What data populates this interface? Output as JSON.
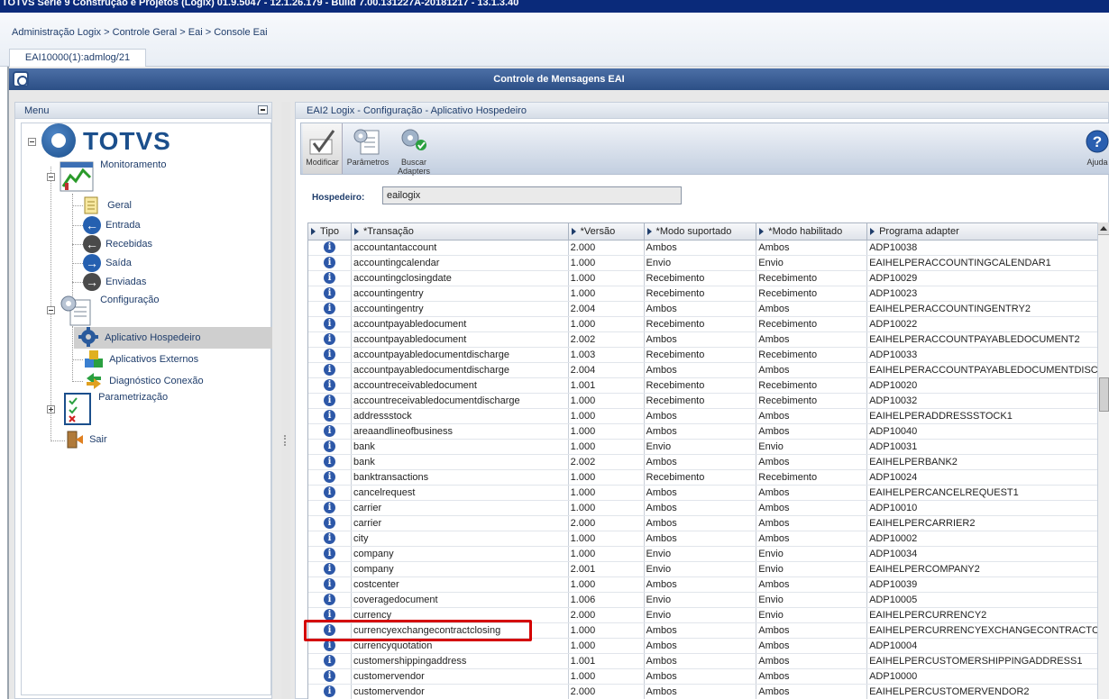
{
  "window": {
    "title": "TOTVS Série 9 Construção e Projetos (Logix) 01.9.5047 - 12.1.26.179 - Build 7.00.131227A-20181217 - 13.1.3.40"
  },
  "breadcrumb": [
    "Administração Logix",
    "Controle Geral",
    "Eai",
    "Console Eai"
  ],
  "breadcrumb_sep": ">",
  "session_tab": "EAI10000(1):admlog/21",
  "header_title": "Controle de Mensagens EAI",
  "menu": {
    "title": "Menu",
    "logo_text": "TOTVS",
    "groups": [
      {
        "label": "Monitoramento",
        "items": [
          "Geral",
          "Entrada",
          "Recebidas",
          "Saída",
          "Enviadas"
        ]
      },
      {
        "label": "Configuração",
        "items": [
          "Aplicativo Hospedeiro",
          "Aplicativos Externos",
          "Diagnóstico Conexão"
        ]
      },
      {
        "label": "Parametrização",
        "items": []
      },
      {
        "label": "Sair",
        "items": []
      }
    ]
  },
  "content": {
    "breadcrumb": "EAI2 Logix - Configuração - Aplicativo Hospedeiro",
    "toolbar": [
      {
        "label": "Modificar",
        "icon": "pencil-check-icon"
      },
      {
        "label": "Parâmetros",
        "icon": "document-gear-icon"
      },
      {
        "label": "Buscar Adapters",
        "icon": "gears-icon"
      }
    ],
    "help_label": "Ajuda",
    "host_label": "Hospedeiro:",
    "host_value": "eailogix"
  },
  "table": {
    "columns": [
      "Tipo",
      "*Transação",
      "*Versão",
      "*Modo suportado",
      "*Modo habilitado",
      "Programa adapter"
    ],
    "rows": [
      [
        "accountantaccount",
        "2.000",
        "Ambos",
        "Ambos",
        "ADP10038"
      ],
      [
        "accountingcalendar",
        "1.000",
        "Envio",
        "Envio",
        "EAIHELPERACCOUNTINGCALENDAR1"
      ],
      [
        "accountingclosingdate",
        "1.000",
        "Recebimento",
        "Recebimento",
        "ADP10029"
      ],
      [
        "accountingentry",
        "1.000",
        "Recebimento",
        "Recebimento",
        "ADP10023"
      ],
      [
        "accountingentry",
        "2.004",
        "Ambos",
        "Ambos",
        "EAIHELPERACCOUNTINGENTRY2"
      ],
      [
        "accountpayabledocument",
        "1.000",
        "Recebimento",
        "Recebimento",
        "ADP10022"
      ],
      [
        "accountpayabledocument",
        "2.002",
        "Ambos",
        "Ambos",
        "EAIHELPERACCOUNTPAYABLEDOCUMENT2"
      ],
      [
        "accountpayabledocumentdischarge",
        "1.003",
        "Recebimento",
        "Recebimento",
        "ADP10033"
      ],
      [
        "accountpayabledocumentdischarge",
        "2.004",
        "Ambos",
        "Ambos",
        "EAIHELPERACCOUNTPAYABLEDOCUMENTDISC"
      ],
      [
        "accountreceivabledocument",
        "1.001",
        "Recebimento",
        "Recebimento",
        "ADP10020"
      ],
      [
        "accountreceivabledocumentdischarge",
        "1.000",
        "Recebimento",
        "Recebimento",
        "ADP10032"
      ],
      [
        "addressstock",
        "1.000",
        "Ambos",
        "Ambos",
        "EAIHELPERADDRESSSTOCK1"
      ],
      [
        "areaandlineofbusiness",
        "1.000",
        "Ambos",
        "Ambos",
        "ADP10040"
      ],
      [
        "bank",
        "1.000",
        "Envio",
        "Envio",
        "ADP10031"
      ],
      [
        "bank",
        "2.002",
        "Ambos",
        "Ambos",
        "EAIHELPERBANK2"
      ],
      [
        "banktransactions",
        "1.000",
        "Recebimento",
        "Recebimento",
        "ADP10024"
      ],
      [
        "cancelrequest",
        "1.000",
        "Ambos",
        "Ambos",
        "EAIHELPERCANCELREQUEST1"
      ],
      [
        "carrier",
        "1.000",
        "Ambos",
        "Ambos",
        "ADP10010"
      ],
      [
        "carrier",
        "2.000",
        "Ambos",
        "Ambos",
        "EAIHELPERCARRIER2"
      ],
      [
        "city",
        "1.000",
        "Ambos",
        "Ambos",
        "ADP10002"
      ],
      [
        "company",
        "1.000",
        "Envio",
        "Envio",
        "ADP10034"
      ],
      [
        "company",
        "2.001",
        "Envio",
        "Envio",
        "EAIHELPERCOMPANY2"
      ],
      [
        "costcenter",
        "1.000",
        "Ambos",
        "Ambos",
        "ADP10039"
      ],
      [
        "coveragedocument",
        "1.006",
        "Envio",
        "Envio",
        "ADP10005"
      ],
      [
        "currency",
        "2.000",
        "Envio",
        "Envio",
        "EAIHELPERCURRENCY2"
      ],
      [
        "currencyexchangecontractclosing",
        "1.000",
        "Ambos",
        "Ambos",
        "EAIHELPERCURRENCYEXCHANGECONTRACTC"
      ],
      [
        "currencyquotation",
        "1.000",
        "Ambos",
        "Ambos",
        "ADP10004"
      ],
      [
        "customershippingaddress",
        "1.001",
        "Ambos",
        "Ambos",
        "EAIHELPERCUSTOMERSHIPPINGADDRESS1"
      ],
      [
        "customervendor",
        "1.000",
        "Ambos",
        "Ambos",
        "ADP10000"
      ],
      [
        "customervendor",
        "2.000",
        "Ambos",
        "Ambos",
        "EAIHELPERCUSTOMERVENDOR2"
      ]
    ]
  }
}
